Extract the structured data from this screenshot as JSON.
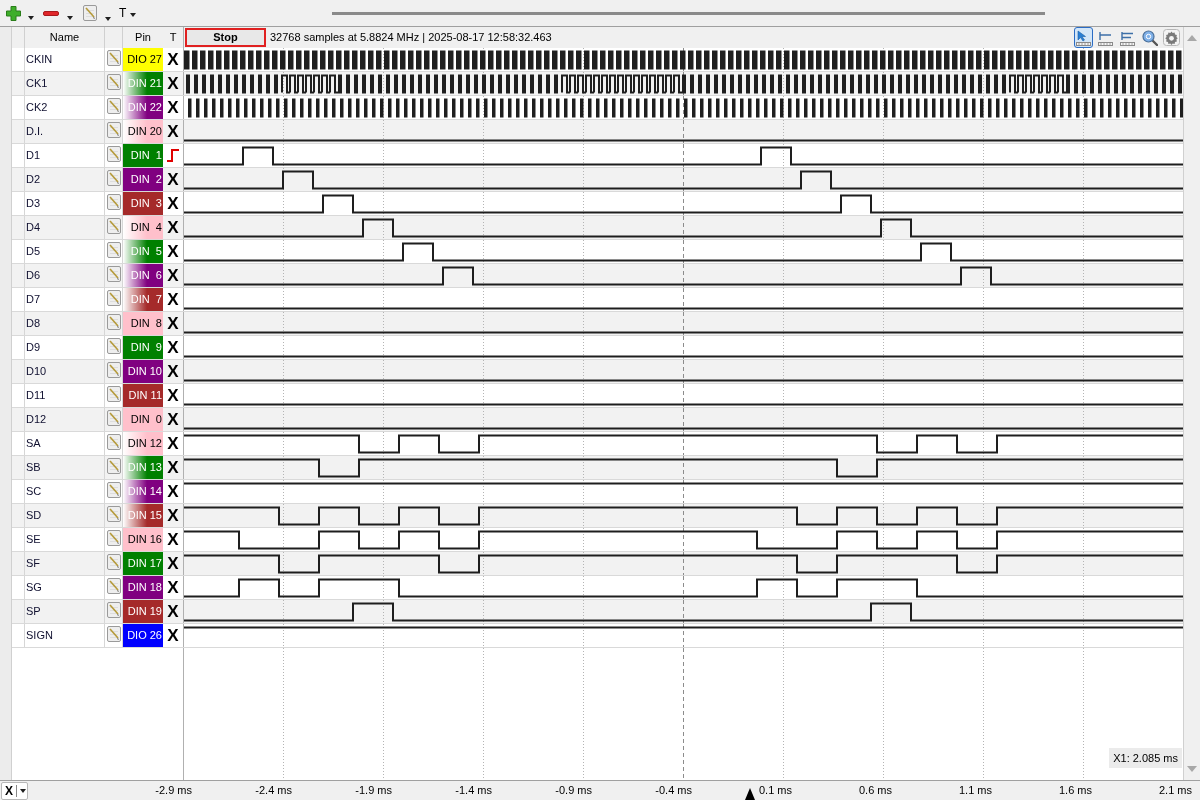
{
  "toolbar": {
    "text_tool": "T"
  },
  "header": {
    "columns": [
      "Name",
      "Pin",
      "T"
    ],
    "stop_button": "Stop",
    "info": "32768 samples at 5.8824 MHz | 2025-08-17 12:58:32.463",
    "tools": [
      {
        "kind": "pointer",
        "selected": true
      },
      {
        "kind": "cursor",
        "selected": false
      },
      {
        "kind": "cursor-pair",
        "selected": false
      },
      {
        "kind": "zoom",
        "selected": false
      },
      {
        "kind": "settings",
        "selected": false
      }
    ]
  },
  "channels": [
    {
      "name": "CKIN",
      "pin": "DIO 27",
      "color": "#ffff00",
      "kind": "solid",
      "trigger": {
        "kind": "symbol",
        "text": "X"
      }
    },
    {
      "name": "CK1",
      "pin": "DIN 21",
      "color": "#008000",
      "kind": "gradient",
      "trigger": {
        "kind": "symbol",
        "text": "X"
      }
    },
    {
      "name": "CK2",
      "pin": "DIN 22",
      "color": "#800080",
      "kind": "gradient",
      "trigger": {
        "kind": "symbol",
        "text": "X"
      }
    },
    {
      "name": "D.I.",
      "pin": "DIN 20",
      "color": "#ffc0cb",
      "kind": "gradient",
      "trigger": {
        "kind": "symbol",
        "text": "X"
      }
    },
    {
      "name": "D1",
      "pin": "DIN  1",
      "color": "#008000",
      "kind": "solid",
      "trigger": {
        "kind": "edge"
      }
    },
    {
      "name": "D2",
      "pin": "DIN  2",
      "color": "#800080",
      "kind": "solid",
      "trigger": {
        "kind": "symbol",
        "text": "X"
      }
    },
    {
      "name": "D3",
      "pin": "DIN  3",
      "color": "#a52a2a",
      "kind": "solid",
      "trigger": {
        "kind": "symbol",
        "text": "X"
      }
    },
    {
      "name": "D4",
      "pin": "DIN  4",
      "color": "#ffc0cb",
      "kind": "gradient",
      "trigger": {
        "kind": "symbol",
        "text": "X"
      }
    },
    {
      "name": "D5",
      "pin": "DIN  5",
      "color": "#008000",
      "kind": "gradient",
      "trigger": {
        "kind": "symbol",
        "text": "X"
      }
    },
    {
      "name": "D6",
      "pin": "DIN  6",
      "color": "#800080",
      "kind": "gradient",
      "trigger": {
        "kind": "symbol",
        "text": "X"
      }
    },
    {
      "name": "D7",
      "pin": "DIN  7",
      "color": "#a52a2a",
      "kind": "gradient",
      "trigger": {
        "kind": "symbol",
        "text": "X"
      }
    },
    {
      "name": "D8",
      "pin": "DIN  8",
      "color": "#ffc0cb",
      "kind": "solid",
      "trigger": {
        "kind": "symbol",
        "text": "X"
      }
    },
    {
      "name": "D9",
      "pin": "DIN  9",
      "color": "#008000",
      "kind": "solid",
      "trigger": {
        "kind": "symbol",
        "text": "X"
      }
    },
    {
      "name": "D10",
      "pin": "DIN 10",
      "color": "#800080",
      "kind": "solid",
      "trigger": {
        "kind": "symbol",
        "text": "X"
      }
    },
    {
      "name": "D11",
      "pin": "DIN 11",
      "color": "#a52a2a",
      "kind": "solid",
      "trigger": {
        "kind": "symbol",
        "text": "X"
      }
    },
    {
      "name": "D12",
      "pin": "DIN  0",
      "color": "#ffc0cb",
      "kind": "solid",
      "trigger": {
        "kind": "symbol",
        "text": "X"
      }
    },
    {
      "name": "SA",
      "pin": "DIN 12",
      "color": "#ffc0cb",
      "kind": "gradient",
      "trigger": {
        "kind": "symbol",
        "text": "X"
      }
    },
    {
      "name": "SB",
      "pin": "DIN 13",
      "color": "#008000",
      "kind": "gradient",
      "trigger": {
        "kind": "symbol",
        "text": "X"
      }
    },
    {
      "name": "SC",
      "pin": "DIN 14",
      "color": "#800080",
      "kind": "gradient",
      "trigger": {
        "kind": "symbol",
        "text": "X"
      }
    },
    {
      "name": "SD",
      "pin": "DIN 15",
      "color": "#a52a2a",
      "kind": "gradient",
      "trigger": {
        "kind": "symbol",
        "text": "X"
      }
    },
    {
      "name": "SE",
      "pin": "DIN 16",
      "color": "#ffc0cb",
      "kind": "solid",
      "trigger": {
        "kind": "symbol",
        "text": "X"
      }
    },
    {
      "name": "SF",
      "pin": "DIN 17",
      "color": "#008000",
      "kind": "solid",
      "trigger": {
        "kind": "symbol",
        "text": "X"
      }
    },
    {
      "name": "SG",
      "pin": "DIN 18",
      "color": "#800080",
      "kind": "solid",
      "trigger": {
        "kind": "symbol",
        "text": "X"
      }
    },
    {
      "name": "SP",
      "pin": "DIN 19",
      "color": "#a52a2a",
      "kind": "solid",
      "trigger": {
        "kind": "symbol",
        "text": "X"
      }
    },
    {
      "name": "SIGN",
      "pin": "DIO 26",
      "color": "#0000ff",
      "kind": "solid",
      "trigger": {
        "kind": "symbol",
        "text": "X"
      }
    }
  ],
  "cursor_readout": "X1: 2.085 ms",
  "axis": {
    "selector": "X",
    "ticks": [
      "-2.9 ms",
      "-2.4 ms",
      "-1.9 ms",
      "-1.4 ms",
      "-0.9 ms",
      "-0.4 ms",
      "0.1 ms",
      "0.6 ms",
      "1.1 ms",
      "1.6 ms",
      "2.1 ms"
    ]
  }
}
